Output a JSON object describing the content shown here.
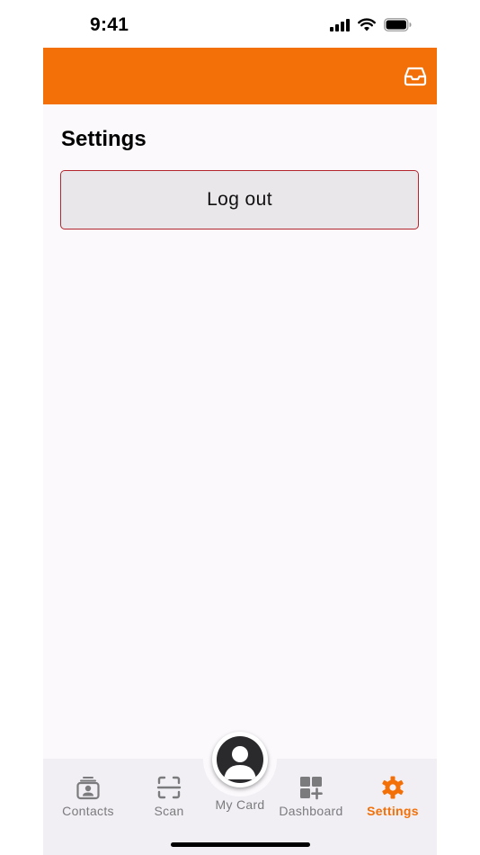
{
  "status_bar": {
    "time": "9:41",
    "icons": [
      "cellular-signal-icon",
      "wifi-icon",
      "battery-icon"
    ]
  },
  "header": {
    "background_color": "#f37008",
    "inbox_icon": "inbox-tray-icon"
  },
  "page": {
    "title": "Settings",
    "logout_label": "Log out",
    "logout_border_color": "#b3262e"
  },
  "tabs": [
    {
      "id": "contacts",
      "label": "Contacts",
      "icon": "contact-card-icon",
      "active": false
    },
    {
      "id": "scan",
      "label": "Scan",
      "icon": "scan-frame-icon",
      "active": false
    },
    {
      "id": "mycard",
      "label": "My Card",
      "icon": "profile-avatar-icon",
      "active": false
    },
    {
      "id": "dashboard",
      "label": "Dashboard",
      "icon": "dashboard-grid-icon",
      "active": false
    },
    {
      "id": "settings",
      "label": "Settings",
      "icon": "gear-icon",
      "active": true
    }
  ],
  "colors": {
    "accent": "#f37008",
    "inactive_tab": "#7b7b7e"
  }
}
